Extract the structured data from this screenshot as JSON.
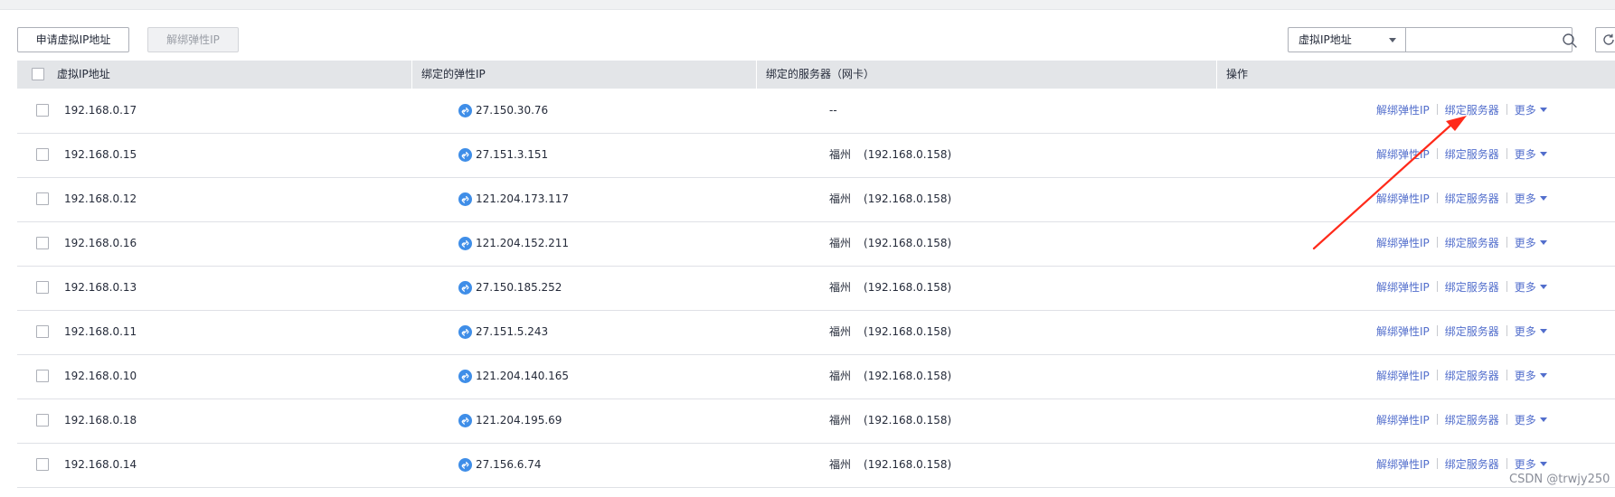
{
  "toolbar": {
    "apply_label": "申请虚拟IP地址",
    "unbind_label": "解绑弹性IP"
  },
  "filter": {
    "selected": "虚拟IP地址",
    "input_value": "",
    "placeholder": ""
  },
  "columns": [
    "虚拟IP地址",
    "绑定的弹性IP",
    "绑定的服务器（网卡）",
    "操作"
  ],
  "actions": {
    "unbind": "解绑弹性IP",
    "bind_server": "绑定服务器",
    "more": "更多"
  },
  "rows": [
    {
      "vip": "192.168.0.17",
      "eip": "27.150.30.76",
      "server": "--",
      "region": "",
      "nic": ""
    },
    {
      "vip": "192.168.0.15",
      "eip": "27.151.3.151",
      "server": "",
      "region": "福州",
      "nic": "(192.168.0.158)"
    },
    {
      "vip": "192.168.0.12",
      "eip": "121.204.173.117",
      "server": "",
      "region": "福州",
      "nic": "(192.168.0.158)"
    },
    {
      "vip": "192.168.0.16",
      "eip": "121.204.152.211",
      "server": "",
      "region": "福州",
      "nic": "(192.168.0.158)"
    },
    {
      "vip": "192.168.0.13",
      "eip": "27.150.185.252",
      "server": "",
      "region": "福州",
      "nic": "(192.168.0.158)"
    },
    {
      "vip": "192.168.0.11",
      "eip": "27.151.5.243",
      "server": "",
      "region": "福州",
      "nic": "(192.168.0.158)"
    },
    {
      "vip": "192.168.0.10",
      "eip": "121.204.140.165",
      "server": "",
      "region": "福州",
      "nic": "(192.168.0.158)"
    },
    {
      "vip": "192.168.0.18",
      "eip": "121.204.195.69",
      "server": "",
      "region": "福州",
      "nic": "(192.168.0.158)"
    },
    {
      "vip": "192.168.0.14",
      "eip": "27.156.6.74",
      "server": "",
      "region": "福州",
      "nic": "(192.168.0.158)"
    }
  ],
  "watermark": "CSDN @trwjy250",
  "icons": {
    "search": "search-icon",
    "refresh": "refresh-icon",
    "eip": "elastic-ip-link-icon",
    "dropdown": "chevron-down-icon"
  },
  "colors": {
    "link": "#526ecc",
    "eip_icon": "#3f8ee8",
    "header_bg": "#e3e5e8",
    "annotation_arrow": "#ff2a1a"
  }
}
